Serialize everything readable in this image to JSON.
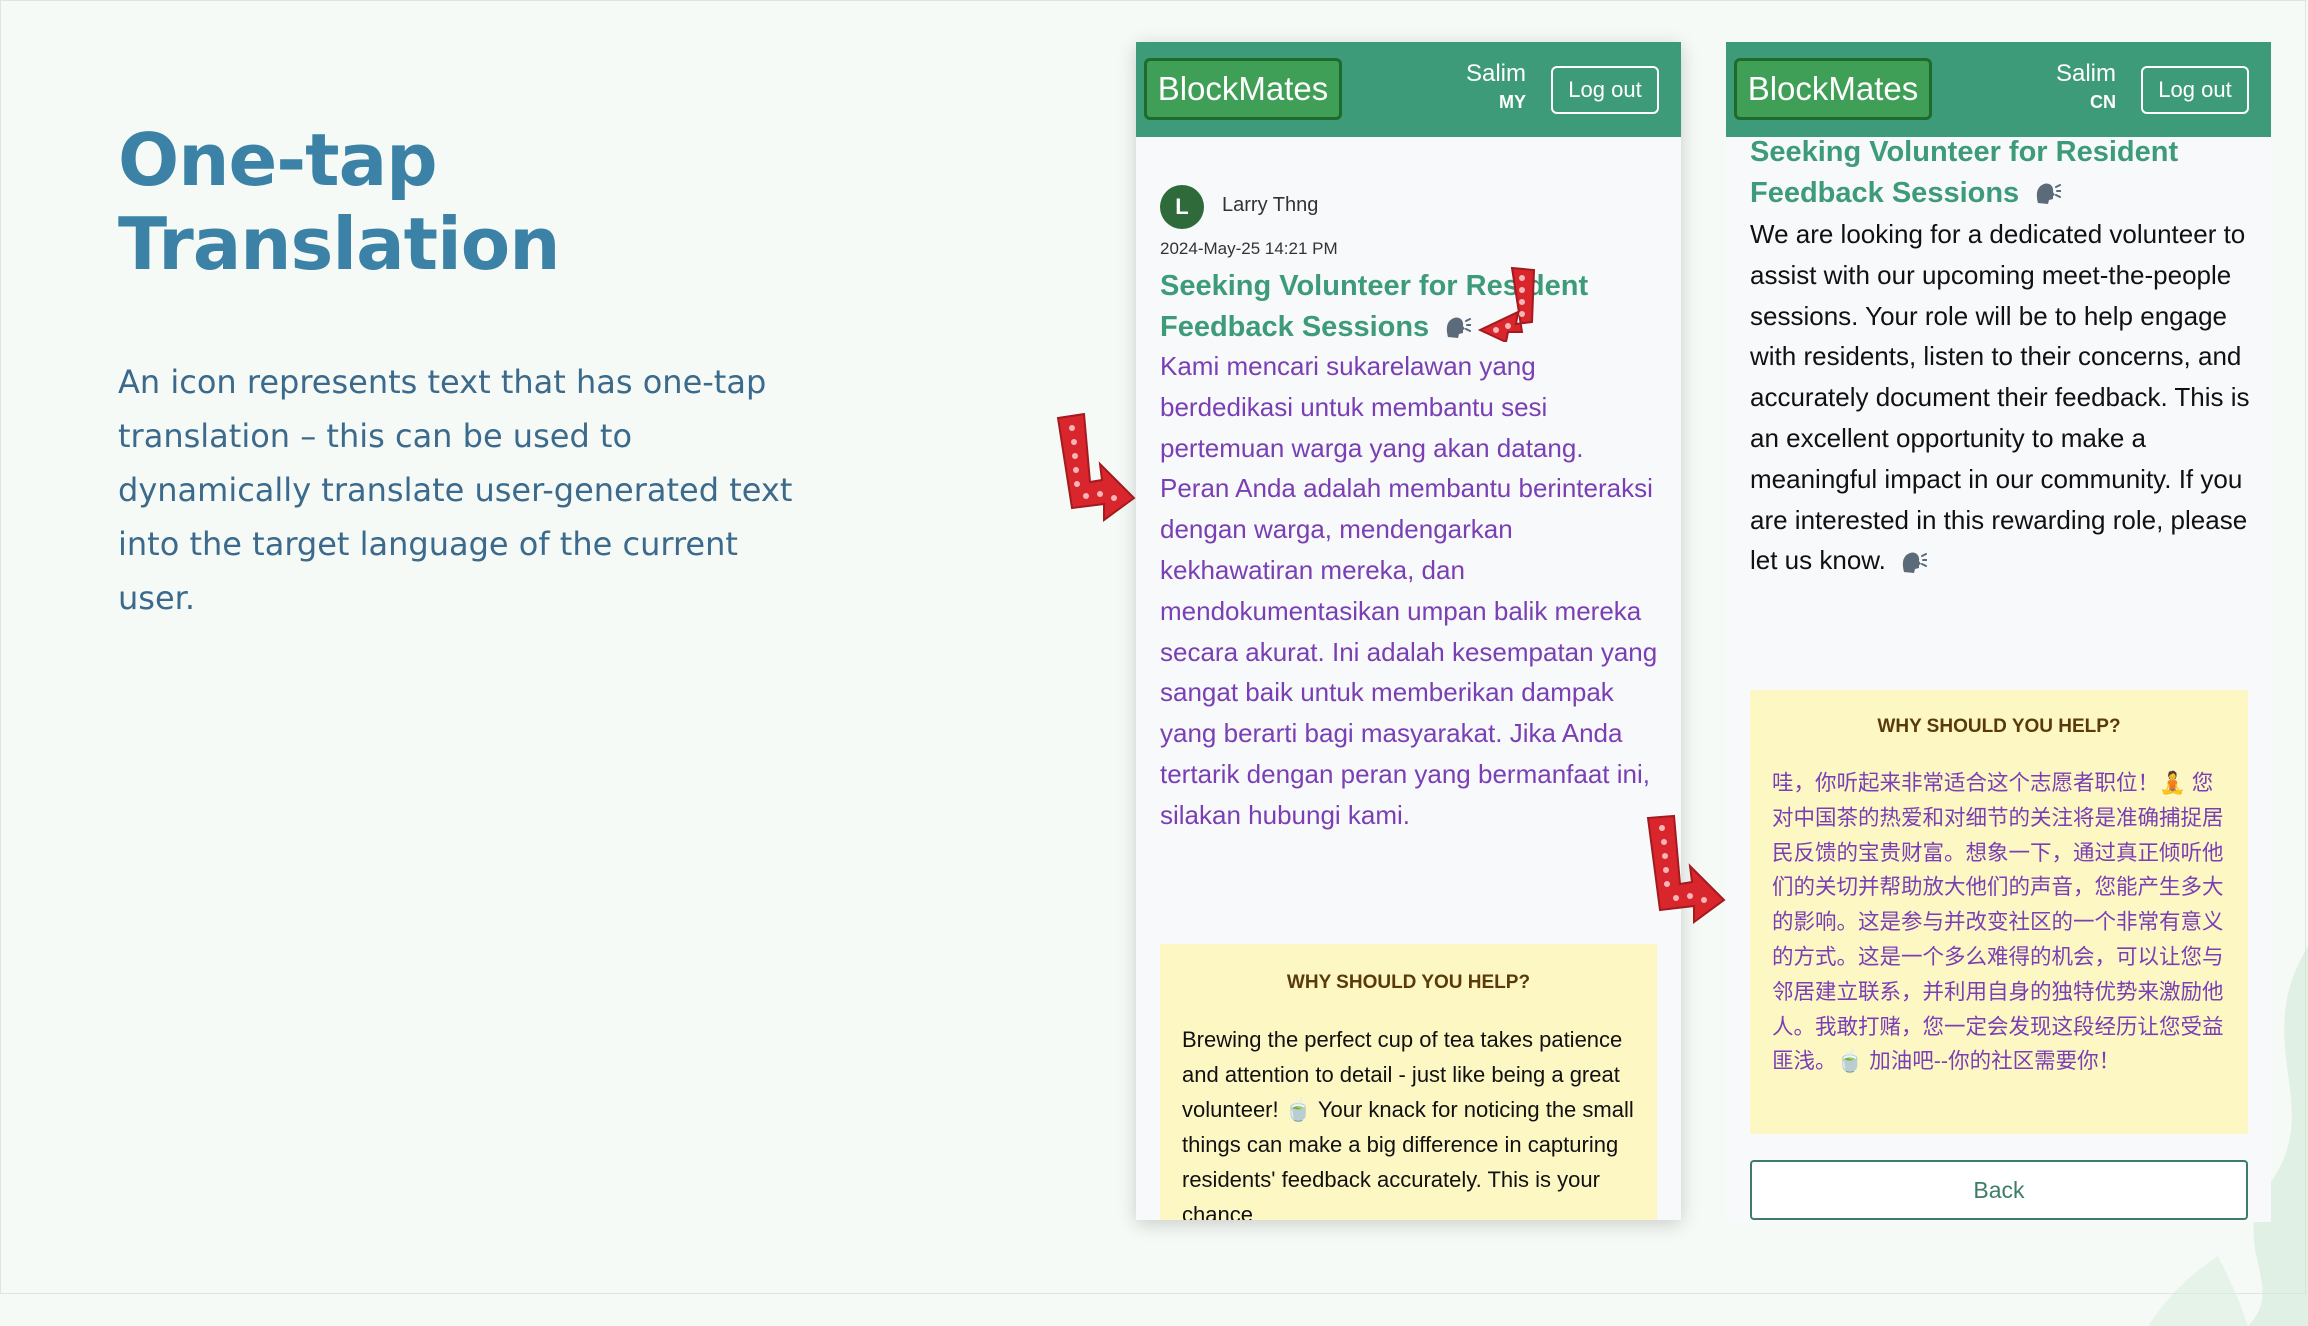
{
  "slide": {
    "title_line1": "One-tap",
    "title_line2": "Translation",
    "description": "An icon represents text that has one-tap translation – this can be used to dynamically translate user-generated text into the target language of the current user."
  },
  "colors": {
    "header_green": "#3e9b79",
    "logo_green": "#3f9f57",
    "title_blue": "#3b82a6",
    "translated_purple": "#7a3fb4",
    "help_box_yellow": "#fdf7c4",
    "arrow_red": "#d8262c"
  },
  "icons": {
    "speak": "speaking-head-icon",
    "arrow": "marquee-down-right-arrow-icon"
  },
  "phone_my": {
    "logo": "BlockMates",
    "user_name": "Salim",
    "user_lang": "MY",
    "logout": "Log out",
    "avatar_letter": "L",
    "author": "Larry Thng",
    "timestamp": "2024-May-25 14:21 PM",
    "post_title_line1": "Seeking Volunteer for Resident",
    "post_title_line2": "Feedback Sessions",
    "post_body": "Kami mencari sukarelawan yang berdedikasi untuk membantu sesi pertemuan warga yang akan datang. Peran Anda adalah membantu berinteraksi dengan warga, mendengarkan kekhawatiran mereka, dan mendokumentasikan umpan balik mereka secara akurat. Ini adalah kesempatan yang sangat baik untuk memberikan dampak yang berarti bagi masyarakat. Jika Anda tertarik dengan peran yang bermanfaat ini, silakan hubungi kami.",
    "help_title": "WHY SHOULD YOU HELP?",
    "help_text": "Brewing the perfect cup of tea takes patience and attention to detail - just like being a great volunteer! 🍵 Your knack for noticing the small things can make a big difference in capturing residents' feedback accurately. This is your chance"
  },
  "phone_cn": {
    "logo": "BlockMates",
    "user_name": "Salim",
    "user_lang": "CN",
    "logout": "Log out",
    "post_title_line1": "Seeking Volunteer for Resident",
    "post_title_line2": "Feedback Sessions",
    "post_body": "We are looking for a dedicated volunteer to assist with our upcoming meet-the-people sessions. Your role will be to help engage with residents, listen to their concerns, and accurately document their feedback. This is an excellent opportunity to make a meaningful impact in our community. If you are interested in this rewarding role, please let us know.",
    "help_title": "WHY SHOULD YOU HELP?",
    "help_text": "哇，你听起来非常适合这个志愿者职位！🧘 您对中国茶的热爱和对细节的关注将是准确捕捉居民反馈的宝贵财富。想象一下，通过真正倾听他们的关切并帮助放大他们的声音，您能产生多大的影响。这是参与并改变社区的一个非常有意义的方式。这是一个多么难得的机会，可以让您与邻居建立联系，并利用自身的独特优势来激励他人。我敢打赌，您一定会发现这段经历让您受益匪浅。🍵 加油吧--你的社区需要你！",
    "back": "Back"
  }
}
